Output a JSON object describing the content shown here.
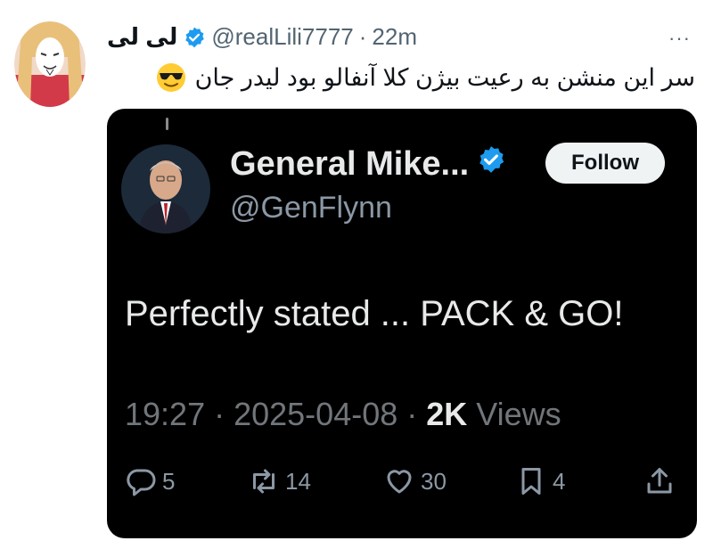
{
  "post": {
    "author_name": "لی لی",
    "author_handle": "@realLili7777",
    "separator": "·",
    "time_ago": "22m",
    "more": "···",
    "text": "سر این منشن به رعیت بیژن کلا آنفالو بود لیدر جان",
    "emoji": "smiling-face-with-sunglasses"
  },
  "quoted": {
    "author_name": "General Mike...",
    "author_handle": "@GenFlynn",
    "follow_label": "Follow",
    "text": "Perfectly stated ... PACK & GO!",
    "time": "19:27",
    "sep1": " · ",
    "date": "2025-04-08",
    "sep2": " · ",
    "views_count": "2K",
    "views_label": " Views",
    "replies": "5",
    "reposts": "14",
    "likes": "30",
    "bookmarks": "4"
  },
  "colors": {
    "verified": "#1d9bf0",
    "card_bg": "#000000",
    "muted": "#536471",
    "card_muted": "#71767b"
  }
}
